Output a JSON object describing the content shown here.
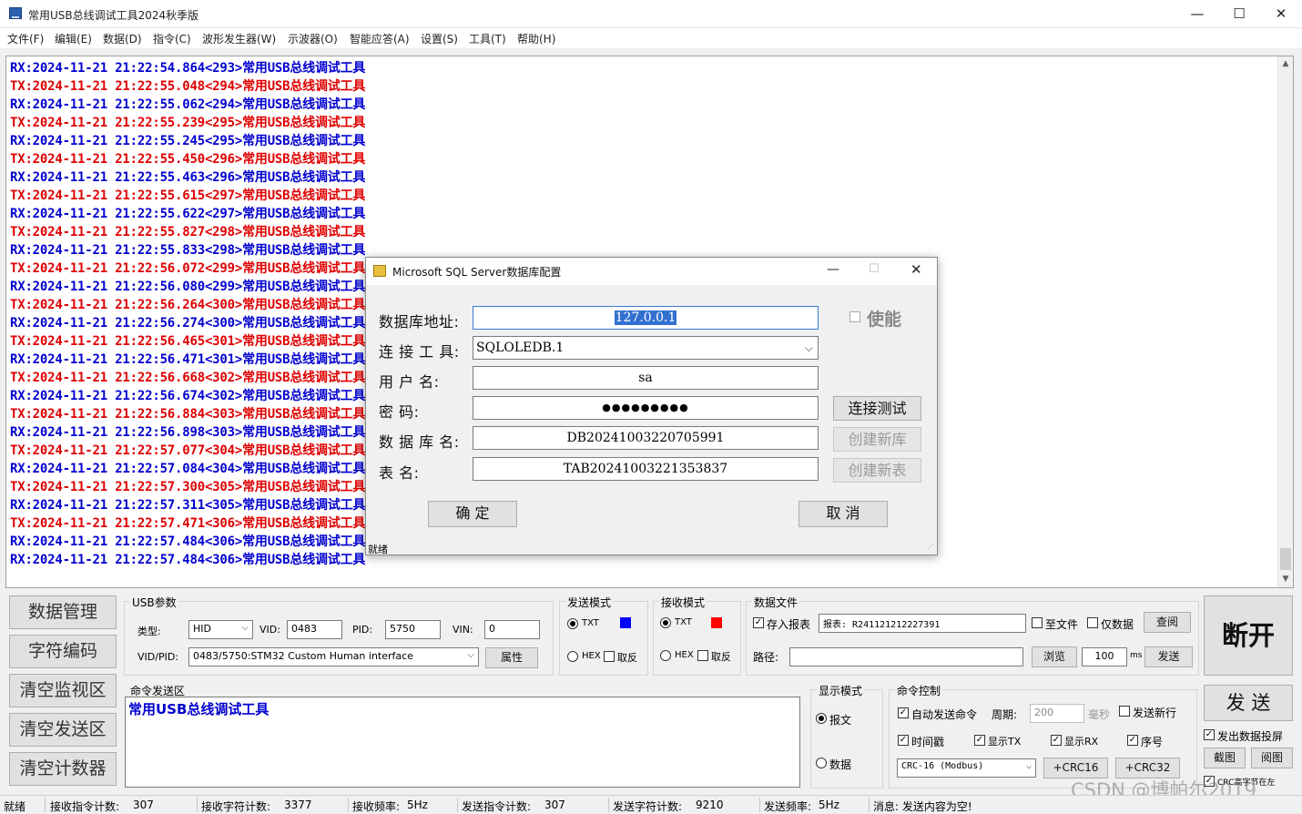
{
  "window": {
    "title": "常用USB总线调试工具2024秋季版",
    "min": "—",
    "max": "☐",
    "close": "✕"
  },
  "menu": [
    "文件(F)",
    "编辑(E)",
    "数据(D)",
    "指令(C)",
    "波形发生器(W)",
    "示波器(O)",
    "智能应答(A)",
    "设置(S)",
    "工具(T)",
    "帮助(H)"
  ],
  "log": [
    {
      "dir": "RX",
      "text": "RX:2024-11-21 21:22:54.864<293>常用USB总线调试工具"
    },
    {
      "dir": "TX",
      "text": "TX:2024-11-21 21:22:55.048<294>常用USB总线调试工具"
    },
    {
      "dir": "RX",
      "text": "RX:2024-11-21 21:22:55.062<294>常用USB总线调试工具"
    },
    {
      "dir": "TX",
      "text": "TX:2024-11-21 21:22:55.239<295>常用USB总线调试工具"
    },
    {
      "dir": "RX",
      "text": "RX:2024-11-21 21:22:55.245<295>常用USB总线调试工具"
    },
    {
      "dir": "TX",
      "text": "TX:2024-11-21 21:22:55.450<296>常用USB总线调试工具"
    },
    {
      "dir": "RX",
      "text": "RX:2024-11-21 21:22:55.463<296>常用USB总线调试工具"
    },
    {
      "dir": "TX",
      "text": "TX:2024-11-21 21:22:55.615<297>常用USB总线调试工具"
    },
    {
      "dir": "RX",
      "text": "RX:2024-11-21 21:22:55.622<297>常用USB总线调试工具"
    },
    {
      "dir": "TX",
      "text": "TX:2024-11-21 21:22:55.827<298>常用USB总线调试工具"
    },
    {
      "dir": "RX",
      "text": "RX:2024-11-21 21:22:55.833<298>常用USB总线调试工具"
    },
    {
      "dir": "TX",
      "text": "TX:2024-11-21 21:22:56.072<299>常用USB总线调试工具"
    },
    {
      "dir": "RX",
      "text": "RX:2024-11-21 21:22:56.080<299>常用USB总线调试工具"
    },
    {
      "dir": "TX",
      "text": "TX:2024-11-21 21:22:56.264<300>常用USB总线调试工具"
    },
    {
      "dir": "RX",
      "text": "RX:2024-11-21 21:22:56.274<300>常用USB总线调试工具"
    },
    {
      "dir": "TX",
      "text": "TX:2024-11-21 21:22:56.465<301>常用USB总线调试工具"
    },
    {
      "dir": "RX",
      "text": "RX:2024-11-21 21:22:56.471<301>常用USB总线调试工具"
    },
    {
      "dir": "TX",
      "text": "TX:2024-11-21 21:22:56.668<302>常用USB总线调试工具"
    },
    {
      "dir": "RX",
      "text": "RX:2024-11-21 21:22:56.674<302>常用USB总线调试工具"
    },
    {
      "dir": "TX",
      "text": "TX:2024-11-21 21:22:56.884<303>常用USB总线调试工具"
    },
    {
      "dir": "RX",
      "text": "RX:2024-11-21 21:22:56.898<303>常用USB总线调试工具"
    },
    {
      "dir": "TX",
      "text": "TX:2024-11-21 21:22:57.077<304>常用USB总线调试工具"
    },
    {
      "dir": "RX",
      "text": "RX:2024-11-21 21:22:57.084<304>常用USB总线调试工具"
    },
    {
      "dir": "TX",
      "text": "TX:2024-11-21 21:22:57.300<305>常用USB总线调试工具"
    },
    {
      "dir": "RX",
      "text": "RX:2024-11-21 21:22:57.311<305>常用USB总线调试工具"
    },
    {
      "dir": "TX",
      "text": "TX:2024-11-21 21:22:57.471<306>常用USB总线调试工具"
    },
    {
      "dir": "RX",
      "text": "RX:2024-11-21 21:22:57.484<306>常用USB总线调试工具"
    },
    {
      "dir": "RX",
      "text": "RX:2024-11-21 21:22:57.484<306>常用USB总线调试工具"
    }
  ],
  "colors": {
    "rx": "#0000d0",
    "tx": "#e00000",
    "txt_send_color": "#0000ff",
    "txt_recv_color": "#ff0000"
  },
  "left_buttons": [
    "数据管理",
    "字符编码",
    "清空监视区",
    "清空发送区",
    "清空计数器"
  ],
  "usb": {
    "title": "USB参数",
    "type_label": "类型:",
    "type_value": "HID",
    "vid_label": "VID:",
    "vid_value": "0483",
    "pid_label": "PID:",
    "pid_value": "5750",
    "vin_label": "VIN:",
    "vin_value": "0",
    "vidpid_label": "VID/PID:",
    "vidpid_value": "0483/5750:STM32 Custom Human interface",
    "prop_button": "属性"
  },
  "send_mode": {
    "title": "发送模式",
    "txt": "TXT",
    "hex": "HEX",
    "invert": "取反"
  },
  "recv_mode": {
    "title": "接收模式",
    "txt": "TXT",
    "hex": "HEX",
    "invert": "取反"
  },
  "data_file": {
    "title": "数据文件",
    "save_report": "存入报表",
    "report_value": "报表: R241121212227391",
    "to_file": "至文件",
    "data_only": "仅数据",
    "query_button": "查阅",
    "path_label": "路径:",
    "path_value": "",
    "browse_button": "浏览",
    "ms_value": "100",
    "ms_unit": "ms",
    "send_button": "发送"
  },
  "disconnect_button": "断开",
  "cmd_send": {
    "title": "命令发送区",
    "text": "常用USB总线调试工具"
  },
  "display_mode": {
    "title": "显示模式",
    "report": "报文",
    "data": "数据"
  },
  "cmd_control": {
    "title": "命令控制",
    "auto_send": "自动发送命令",
    "period_label": "周期:",
    "period_value": "200",
    "ms_label": "毫秒",
    "send_newline": "发送新行",
    "timestamp": "时间戳",
    "show_tx": "显示TX",
    "show_rx": "显示RX",
    "seq": "序号",
    "crc_value": "CRC-16 (Modbus)",
    "crc16_button": "+CRC16",
    "crc32_button": "+CRC32"
  },
  "send_button": "发 送",
  "right_panel": {
    "send_cast": "发出数据投屏",
    "screenshot_button": "截图",
    "view_button": "阅图",
    "crc_high": "CRC高字节在左"
  },
  "status": {
    "ready": "就绪",
    "recv_cmd_label": "接收指令计数:",
    "recv_cmd_value": "307",
    "recv_char_label": "接收字符计数:",
    "recv_char_value": "3377",
    "recv_freq_label": "接收频率:",
    "recv_freq_value": "5Hz",
    "send_cmd_label": "发送指令计数:",
    "send_cmd_value": "307",
    "send_char_label": "发送字符计数:",
    "send_char_value": "9210",
    "send_freq_label": "发送频率:",
    "send_freq_value": "5Hz",
    "msg": "消息: 发送内容为空!"
  },
  "dialog": {
    "title": "Microsoft SQL Server数据库配置",
    "addr_label": "数据库地址:",
    "addr_value": "127.0.0.1",
    "enable": "使能",
    "tool_label": "连 接 工 具:",
    "tool_value": "SQLOLEDB.1",
    "user_label": "用   户   名:",
    "user_value": "sa",
    "pwd_label": "密        码:",
    "pwd_value": "●●●●●●●●●",
    "db_label": "数 据 库 名:",
    "db_value": "DB20241003220705991",
    "table_label": "表        名:",
    "table_value": "TAB20241003221353837",
    "test_button": "连接测试",
    "newdb_button": "创建新库",
    "newtable_button": "创建新表",
    "ok_button": "确 定",
    "cancel_button": "取 消",
    "status": "就绪"
  },
  "watermark": "CSDN @博帕尔2019"
}
